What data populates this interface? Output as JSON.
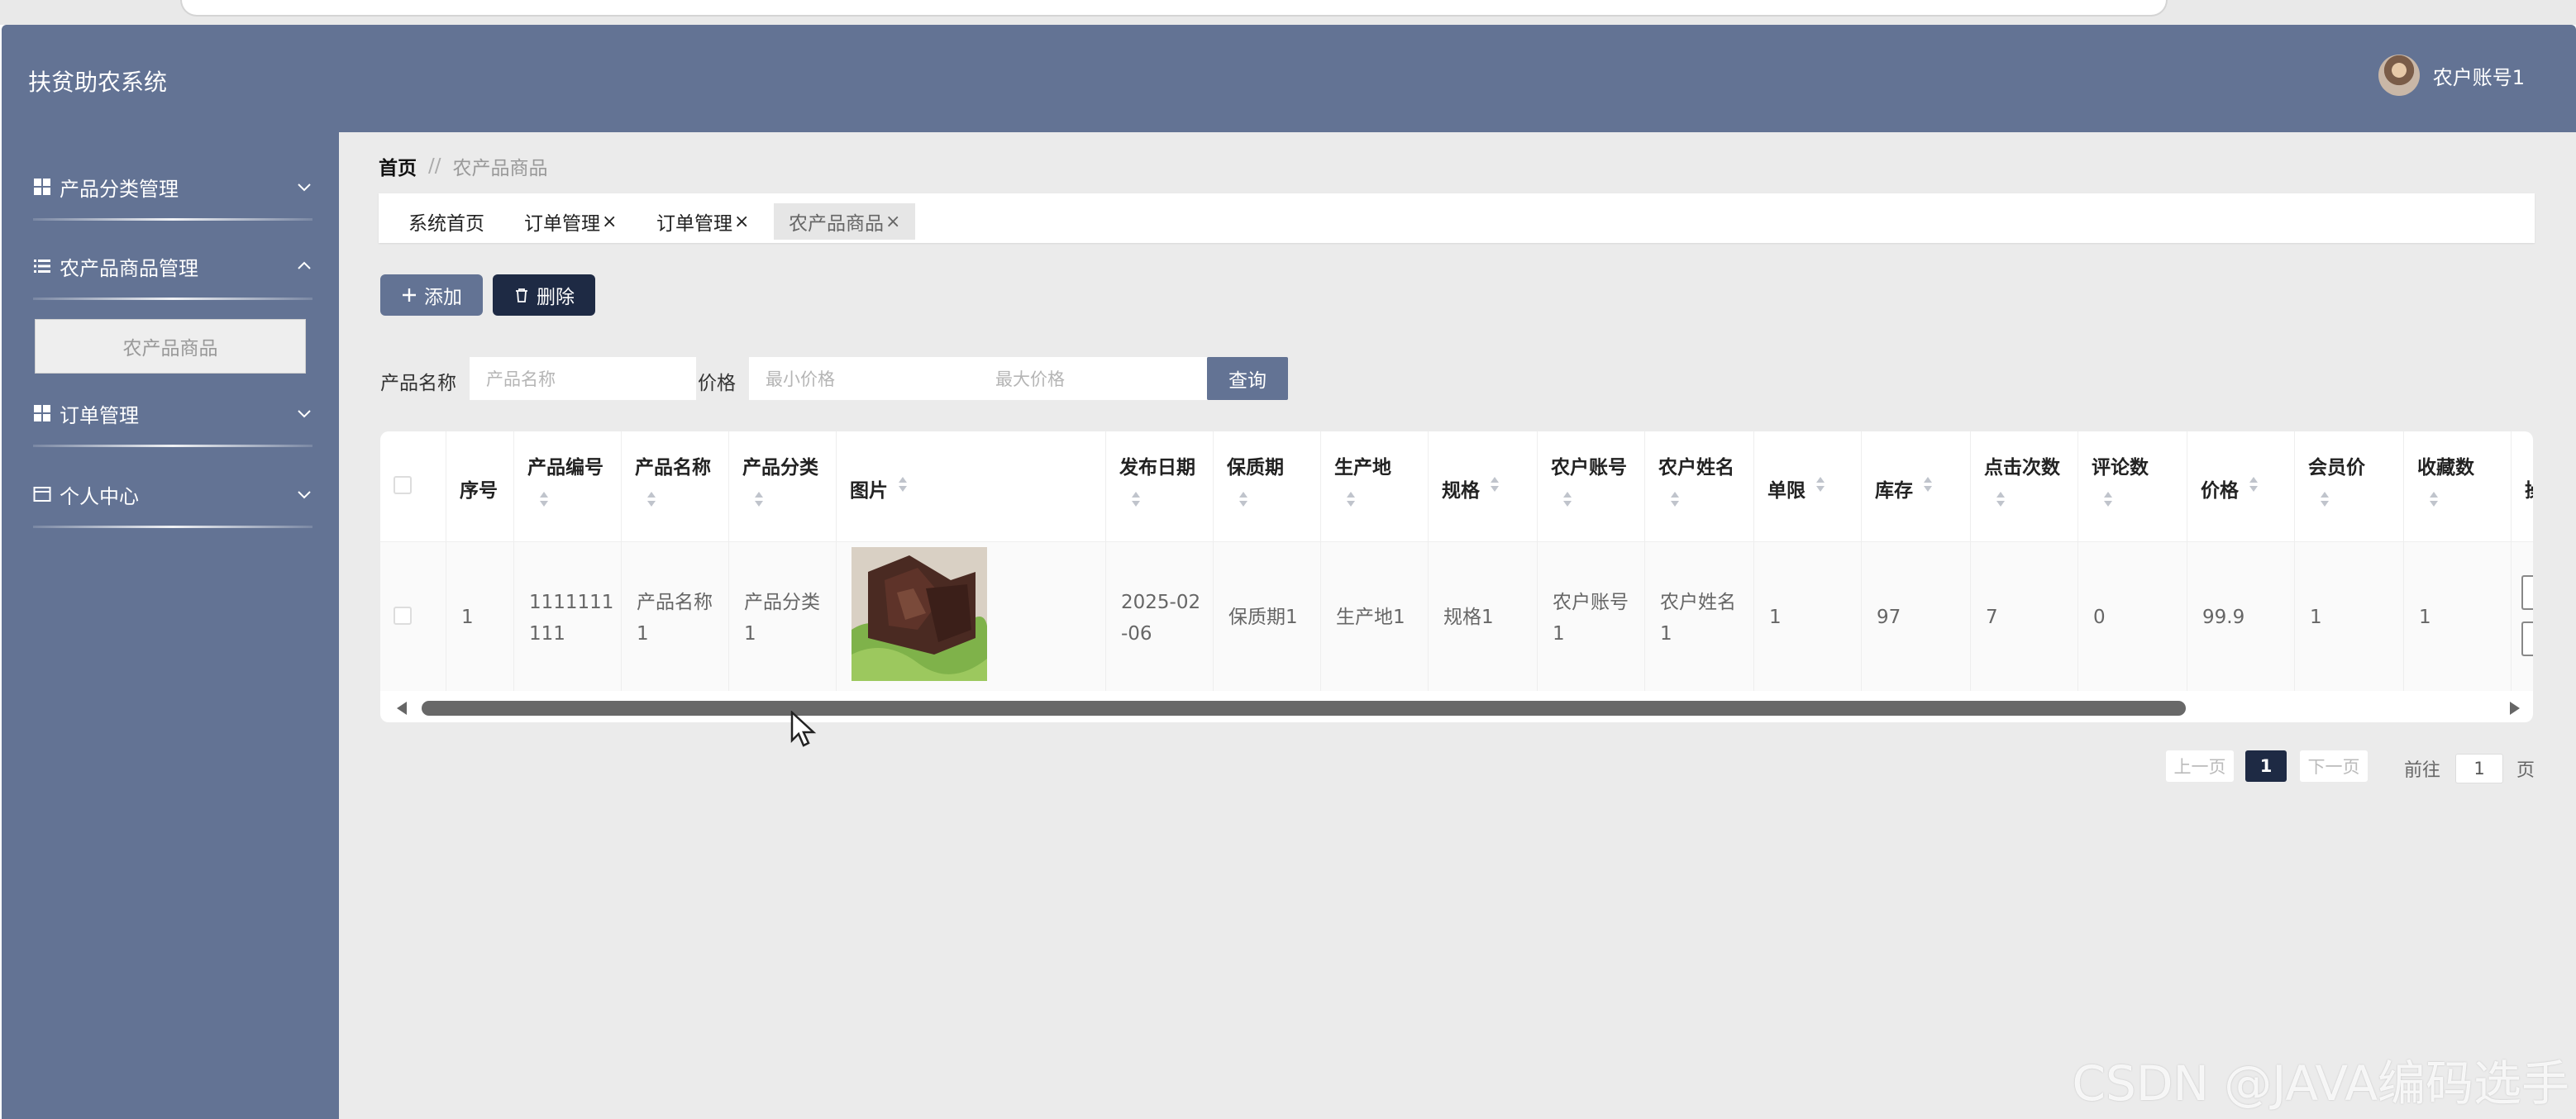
{
  "app": {
    "title": "扶贫助农系统",
    "user_name": "农户账号1"
  },
  "sidebar": {
    "items": [
      {
        "label": "产品分类管理",
        "icon": "grid-icon",
        "expanded": false
      },
      {
        "label": "农产品商品管理",
        "icon": "list-icon",
        "expanded": true,
        "children": [
          {
            "label": "农产品商品"
          }
        ]
      },
      {
        "label": "订单管理",
        "icon": "grid-icon",
        "expanded": false
      },
      {
        "label": "个人中心",
        "icon": "card-icon",
        "expanded": false
      }
    ]
  },
  "breadcrumb": {
    "home": "首页",
    "separator": "//",
    "current": "农产品商品"
  },
  "tabs": [
    {
      "label": "系统首页",
      "closable": false
    },
    {
      "label": "订单管理",
      "closable": true
    },
    {
      "label": "订单管理",
      "closable": true
    },
    {
      "label": "农产品商品",
      "closable": true,
      "active": true
    }
  ],
  "tab_close": "×",
  "toolbar": {
    "add_label": "添加",
    "delete_label": "删除"
  },
  "search": {
    "name_label": "产品名称",
    "name_placeholder": "产品名称",
    "price_label": "价格",
    "min_price_placeholder": "最小价格",
    "max_price_placeholder": "最大价格",
    "query_label": "查询"
  },
  "table": {
    "headers": [
      "序号",
      "产品编号",
      "产品名称",
      "产品分类",
      "图片",
      "发布日期",
      "保质期",
      "生产地",
      "规格",
      "农户账号",
      "农户姓名",
      "单限",
      "库存",
      "点击次数",
      "评论数",
      "价格",
      "会员价",
      "收藏数",
      "操"
    ],
    "rows": [
      {
        "index": "1",
        "code": "1111111\n111",
        "name": "产品名称\n1",
        "category": "产品分类\n1",
        "date": "2025-02\n-06",
        "shelf_life": "保质期1",
        "origin": "生产地1",
        "spec": "规格1",
        "farmer_account": "农户账号\n1",
        "farmer_name": "农户姓名\n1",
        "limit": "1",
        "stock": "97",
        "clicks": "7",
        "comments": "0",
        "price": "99.9",
        "member_price": "1",
        "favorites": "1"
      }
    ]
  },
  "pagination": {
    "prev": "上一页",
    "current": "1",
    "next": "下一页",
    "goto_label": "前往",
    "goto_value": "1",
    "page_suffix": "页"
  },
  "watermark": "CSDN @JAVA编码选手",
  "colors": {
    "primary": "#637394",
    "dark": "#1e2a44",
    "background": "#ebebeb"
  }
}
